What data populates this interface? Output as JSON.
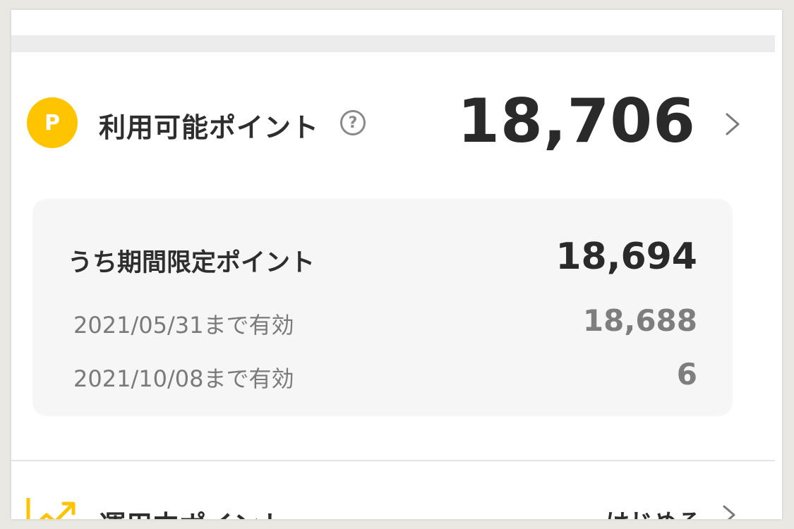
{
  "points": {
    "badge_letter": "P",
    "label": "利用可能ポイント",
    "help_symbol": "?",
    "value": "18,706"
  },
  "limited": {
    "title": "うち期間限定ポイント",
    "total": "18,694",
    "expiries": [
      {
        "date": "2021/05/31まで有効",
        "value": "18,688"
      },
      {
        "date": "2021/10/08まで有効",
        "value": "6"
      }
    ]
  },
  "bottom": {
    "label": "運用中ポイント",
    "link": "はじめる"
  },
  "colors": {
    "accent_yellow": "#ffc400",
    "text_dark": "#2e2e2e",
    "text_muted": "#7a7a7a",
    "card_bg": "#f6f6f6",
    "divider": "#ececec"
  },
  "icons": {
    "badge": "p-badge-icon",
    "help": "help-icon",
    "chevron": "chevron-right-icon",
    "trend": "trend-up-icon"
  }
}
